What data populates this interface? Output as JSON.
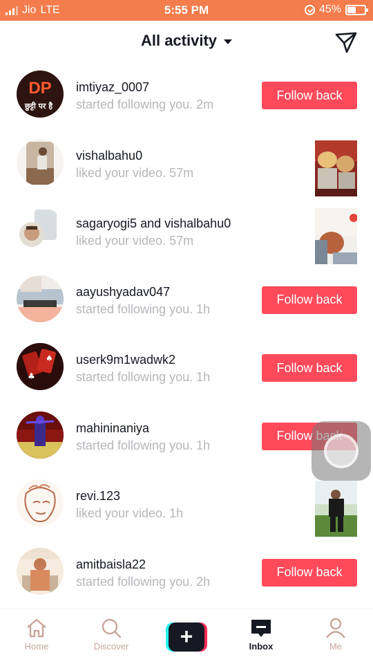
{
  "status_bar": {
    "carrier": "Jio",
    "network": "LTE",
    "time": "5:55 PM",
    "battery": "45%",
    "battery_level": 0.45
  },
  "header": {
    "title": "All activity",
    "send_icon": "send-icon"
  },
  "activities": [
    {
      "user": "imtiyaz_0007",
      "text": "started following you.",
      "time": "2m",
      "action": "Follow back",
      "avatar_text": "DP",
      "avatar_subtext": "छुट्टी पर है"
    },
    {
      "user": "vishalbahu0",
      "text": "liked your video.",
      "time": "57m",
      "thumbnail": true
    },
    {
      "user": "sagaryogi5",
      "and": "and",
      "user2": "vishalbahu0",
      "text": "liked your video.",
      "time": "57m",
      "thumbnail": true
    },
    {
      "user": "aayushyadav047",
      "text": "started following you.",
      "time": "1h",
      "action": "Follow back"
    },
    {
      "user": "userk9m1wadwk2",
      "text": "started following you.",
      "time": "1h",
      "action": "Follow back"
    },
    {
      "user": "mahininaniya",
      "text": "started following you.",
      "time": "1h",
      "action": "Follow back"
    },
    {
      "user": "revi.123",
      "text": "liked your video.",
      "time": "1h",
      "thumbnail": true
    },
    {
      "user": "amitbaisla22",
      "text": "started following you.",
      "time": "2h",
      "action": "Follow back"
    }
  ],
  "nav": {
    "home": "Home",
    "discover": "Discover",
    "create": "+",
    "inbox": "Inbox",
    "me": "Me"
  },
  "colors": {
    "status_bar": "#f57c4c",
    "follow_button": "#fe4a5b",
    "secondary_text": "#b6b6bc"
  }
}
